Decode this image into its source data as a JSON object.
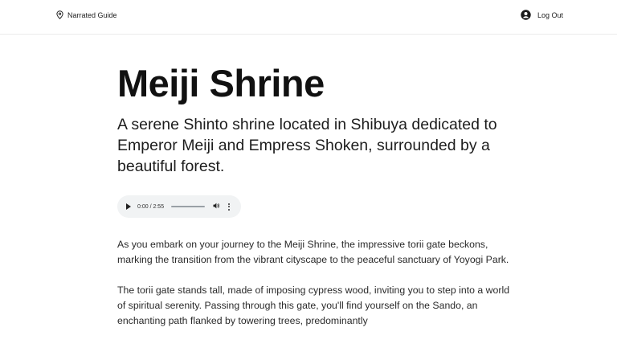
{
  "header": {
    "brand_name": "Narrated Guide",
    "logout_label": "Log Out"
  },
  "page": {
    "title": "Meiji Shrine",
    "subtitle": "A serene Shinto shrine located in Shibuya dedicated to Emperor Meiji and Empress Shoken, surrounded by a beautiful forest."
  },
  "audio": {
    "time_display": "0:00 / 2:55",
    "progress": 0
  },
  "narration": {
    "paragraphs": [
      "As you embark on your journey to the Meiji Shrine, the impressive torii gate beckons, marking the transition from the vibrant cityscape to the peaceful sanctuary of Yoyogi Park.",
      "The torii gate stands tall, made of imposing cypress wood, inviting you to step into a world of spiritual serenity. Passing through this gate, you'll find yourself on the Sando, an enchanting path flanked by towering trees, predominantly"
    ]
  },
  "icons": {
    "brand": "map-pin-icon",
    "logout": "user-circle-icon"
  }
}
